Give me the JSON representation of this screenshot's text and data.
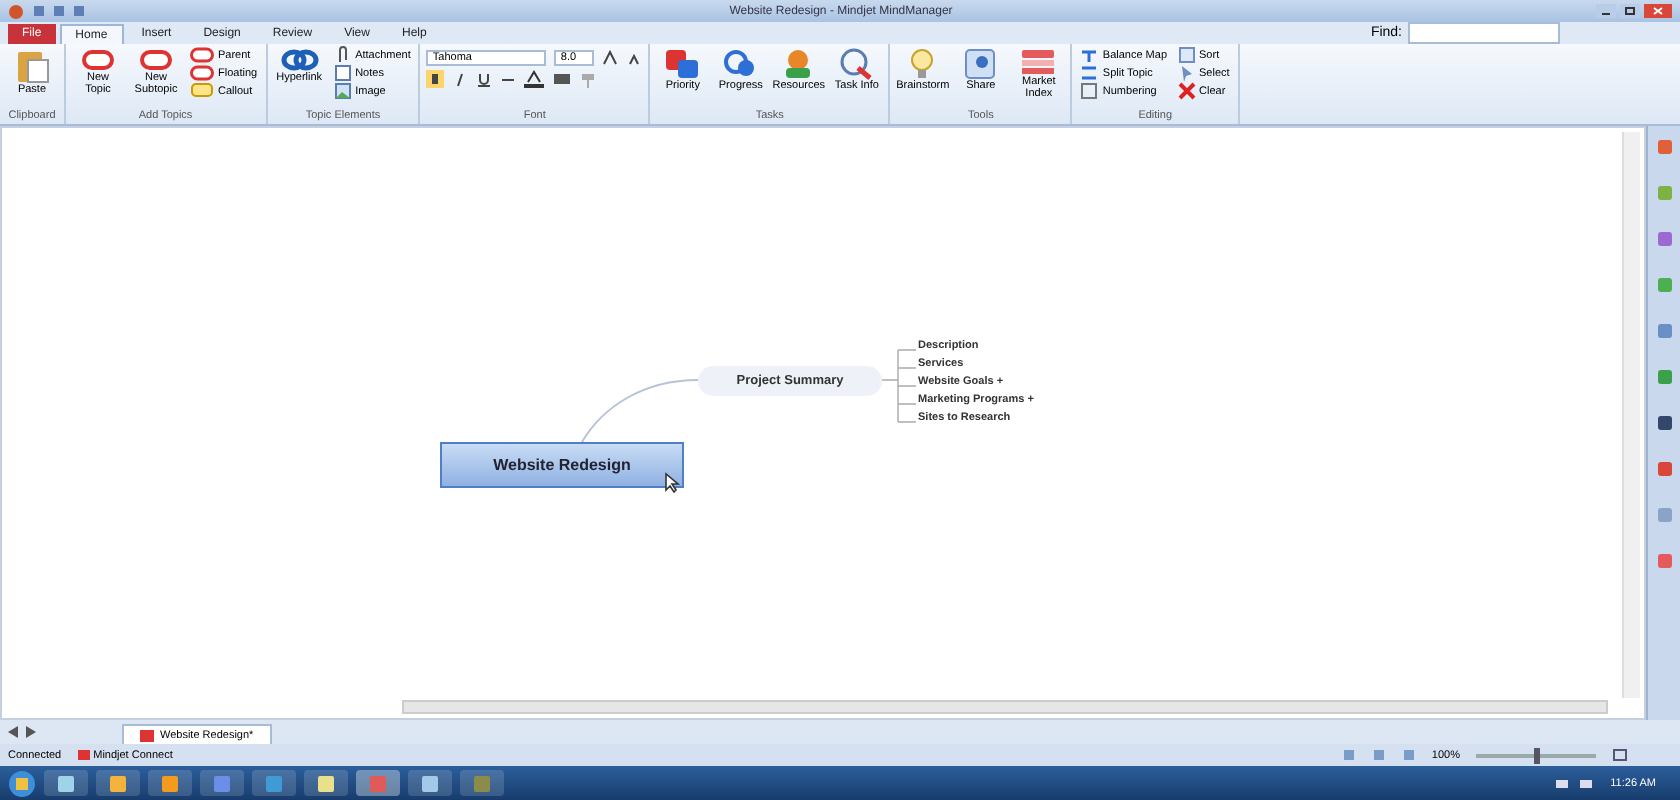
{
  "window": {
    "title": "Website Redesign - Mindjet MindManager"
  },
  "search": {
    "label": "Find:"
  },
  "tabs": [
    {
      "label": "File",
      "selected": false,
      "kind": "file"
    },
    {
      "label": "Home",
      "selected": true,
      "kind": "tab"
    },
    {
      "label": "Insert",
      "selected": false,
      "kind": "tab"
    },
    {
      "label": "Design",
      "selected": false,
      "kind": "tab"
    },
    {
      "label": "Review",
      "selected": false,
      "kind": "tab"
    },
    {
      "label": "View",
      "selected": false,
      "kind": "tab"
    },
    {
      "label": "Help",
      "selected": false,
      "kind": "tab"
    }
  ],
  "ribbon_groups": [
    {
      "name": "Clipboard",
      "kind": "plain",
      "items": [
        {
          "kind": "large",
          "label": "Paste"
        }
      ]
    },
    {
      "name": "Add Topics",
      "kind": "plain",
      "items": [
        {
          "kind": "large",
          "label": "New Topic"
        },
        {
          "kind": "large",
          "label": "New Subtopic"
        },
        {
          "kind": "stack",
          "items": [
            {
              "label": "Parent"
            },
            {
              "label": "Floating"
            },
            {
              "label": "Callout"
            }
          ]
        }
      ]
    },
    {
      "name": "Topic Elements",
      "kind": "plain",
      "items": [
        {
          "kind": "large",
          "label": "Hyperlink"
        },
        {
          "kind": "stack",
          "items": [
            {
              "label": "Attachment"
            },
            {
              "label": "Notes"
            },
            {
              "label": "Image"
            }
          ]
        }
      ]
    },
    {
      "name": "Font",
      "kind": "font",
      "items": [
        {
          "kind": "field",
          "value": "Tahoma"
        },
        {
          "kind": "field",
          "value": "8.0"
        }
      ]
    },
    {
      "name": "Tasks",
      "kind": "plain",
      "items": [
        {
          "kind": "large",
          "label": "Priority"
        },
        {
          "kind": "large",
          "label": "Progress"
        },
        {
          "kind": "large",
          "label": "Resources"
        },
        {
          "kind": "large",
          "label": "Task Info"
        }
      ]
    },
    {
      "name": "Tools",
      "kind": "plain",
      "items": [
        {
          "kind": "large",
          "label": "Brainstorm"
        },
        {
          "kind": "large",
          "label": "Share"
        },
        {
          "kind": "large",
          "label": "Market Index"
        }
      ]
    },
    {
      "name": "Editing",
      "kind": "plain",
      "items": [
        {
          "kind": "stack",
          "items": [
            {
              "label": "Balance Map"
            },
            {
              "label": "Split Topic"
            },
            {
              "label": "Numbering"
            }
          ]
        },
        {
          "kind": "stack",
          "items": [
            {
              "label": "Sort"
            },
            {
              "label": "Select"
            },
            {
              "label": "Clear"
            }
          ]
        }
      ]
    }
  ],
  "map": {
    "central_topic": "Website Redesign",
    "main_topic": "Project Summary",
    "subtopics": [
      "Description",
      "Services",
      "Website Goals +",
      "Marketing Programs +",
      "Sites to Research"
    ]
  },
  "document_tabs": [
    {
      "label": "Website Redesign*",
      "selected": true
    }
  ],
  "status_bar": {
    "connection": "Connected",
    "connect_label": "Mindjet Connect",
    "zoom": "100%",
    "zoom_slider": {
      "level": 0.5
    }
  },
  "taskbar": {
    "clock": "11:26 AM"
  }
}
